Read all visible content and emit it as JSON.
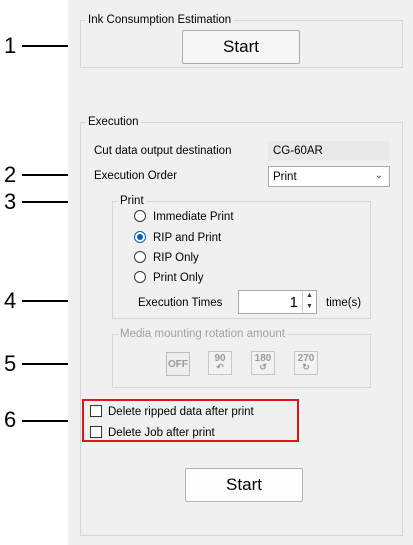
{
  "callouts": [
    "1",
    "2",
    "3",
    "4",
    "5",
    "6"
  ],
  "ink_section": {
    "title": "Ink Consumption Estimation",
    "start_label": "Start"
  },
  "execution": {
    "title": "Execution",
    "cut_label": "Cut data output destination",
    "cut_value": "CG-60AR",
    "order_label": "Execution Order",
    "order_value": "Print",
    "print_group": {
      "title": "Print",
      "options": [
        "Immediate Print",
        "RIP and Print",
        "RIP Only",
        "Print Only"
      ],
      "selected": "RIP and Print"
    },
    "times_label": "Execution Times",
    "times_value": "1",
    "times_unit": "time(s)",
    "rotation": {
      "title": "Media mounting rotation amount",
      "buttons": [
        "OFF",
        "90",
        "180",
        "270"
      ]
    },
    "checks": [
      "Delete ripped data after print",
      "Delete Job after print"
    ],
    "start_label": "Start"
  },
  "colors": {
    "highlight": "#e0141b",
    "radio_selected": "#005fb8"
  }
}
